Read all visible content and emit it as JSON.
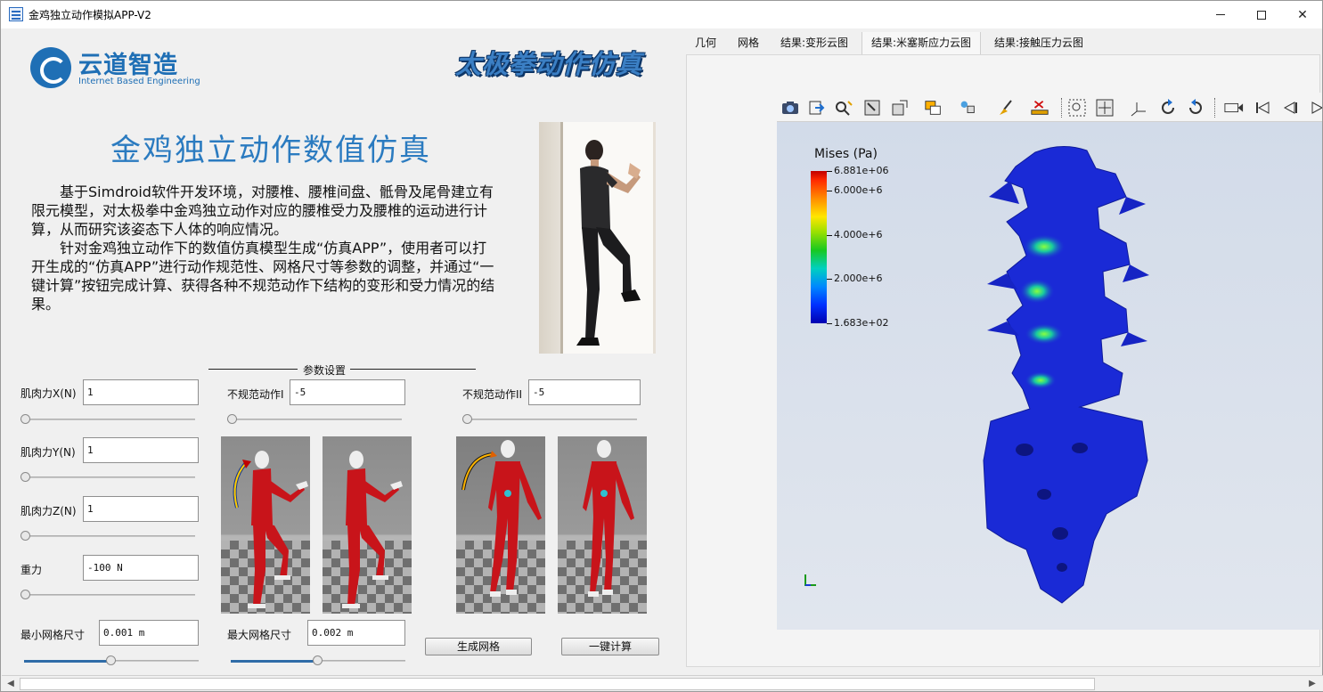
{
  "window": {
    "title": "金鸡独立动作模拟APP-V2",
    "minimize_icon": "minimize-icon",
    "maximize_icon": "maximize-icon",
    "close_label": "✕"
  },
  "logo": {
    "cn": "云道智造",
    "en": "Internet Based Engineering"
  },
  "banner": "太极拳动作仿真",
  "main": {
    "title": "金鸡独立动作数值仿真",
    "paragraph1": "基于Simdroid软件开发环境，对腰椎、腰椎间盘、骶骨及尾骨建立有限元模型，对太极拳中金鸡独立动作对应的腰椎受力及腰椎的运动进行计算，从而研究该姿态下人体的响应情况。",
    "paragraph2": "针对金鸡独立动作下的数值仿真模型生成“仿真APP”，使用者可以打开生成的“仿真APP”进行动作规范性、网格尺寸等参数的调整，并通过“一键计算”按钮完成计算、获得各种不规范动作下结构的变形和受力情况的结果。"
  },
  "params": {
    "section_label": "参数设置",
    "muscle_x": {
      "label": "肌肉力X(N)",
      "value": "1",
      "slider": 0
    },
    "muscle_y": {
      "label": "肌肉力Y(N)",
      "value": "1",
      "slider": 0
    },
    "muscle_z": {
      "label": "肌肉力Z(N)",
      "value": "1",
      "slider": 0
    },
    "gravity": {
      "label": "重力",
      "value": "-100 N",
      "slider": 0
    },
    "irregular1": {
      "label": "不规范动作I",
      "value": "-5",
      "slider": 0
    },
    "irregular2": {
      "label": "不规范动作II",
      "value": "-5",
      "slider": 0
    },
    "min_mesh": {
      "label": "最小网格尺寸",
      "value": "0.001 m",
      "slider": 0.5
    },
    "max_mesh": {
      "label": "最大网格尺寸",
      "value": "0.002 m",
      "slider": 0.5
    }
  },
  "buttons": {
    "generate_mesh": "生成网格",
    "one_click_compute": "一键计算"
  },
  "tabs": [
    {
      "label": "几何"
    },
    {
      "label": "网格"
    },
    {
      "label": "结果:变形云图"
    },
    {
      "label": "结果:米塞斯应力云图"
    },
    {
      "label": "结果:接触压力云图"
    }
  ],
  "active_tab": 3,
  "toolbar_icons": [
    "camera-icon",
    "export-icon",
    "zoom-probe-icon",
    "fit-box-icon",
    "box-icon",
    "layers-icon",
    "lamp-icon",
    "cube-icon",
    "brush-icon",
    "delete-ruler-icon",
    "zoom-region-icon",
    "zoom-all-icon",
    "axes-icon",
    "rotate-cw-icon",
    "rotate-ccw-icon",
    "video-icon",
    "first-frame-icon",
    "prev-frame-icon",
    "play-icon"
  ],
  "legend": {
    "title": "Mises (Pa)",
    "labels": [
      "6.881e+06",
      "6.000e+6",
      "4.000e+6",
      "2.000e+6",
      "1.683e+02"
    ],
    "ticks": [
      6881000.0,
      6000000.0,
      4000000.0,
      2000000.0,
      168.3
    ]
  },
  "colors": {
    "accent": "#2b7bc0",
    "mesh_blue": "#1a2ad6"
  }
}
